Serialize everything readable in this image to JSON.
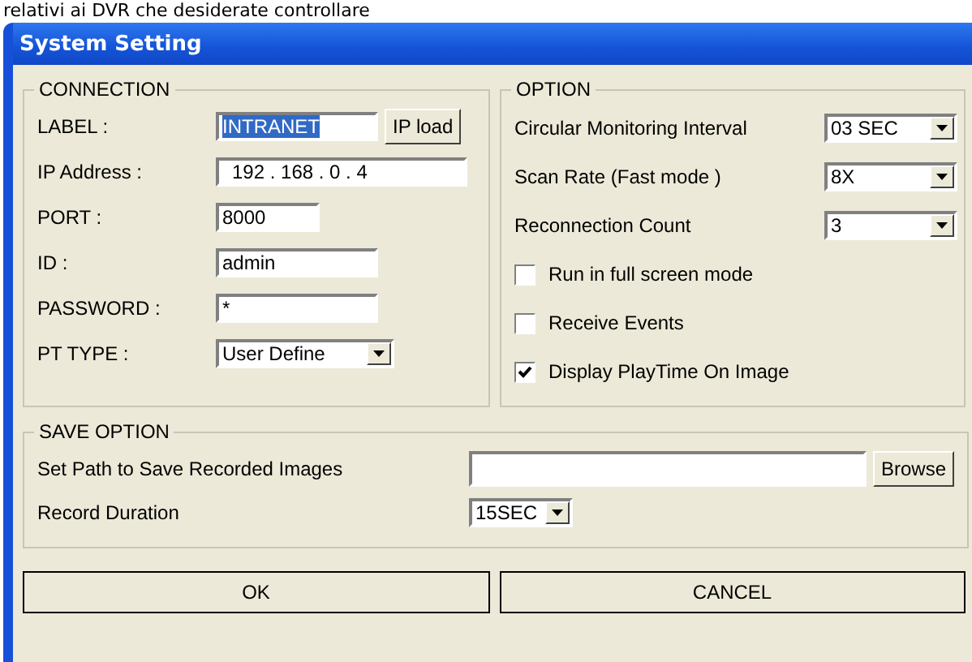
{
  "caption": "relativi ai DVR che desiderate controllare",
  "window": {
    "title": "System Setting"
  },
  "connection": {
    "title": "CONNECTION",
    "rows": [
      {
        "kind": "text",
        "label": "LABEL :",
        "value": "INTRANET",
        "selected": true,
        "button": "IP load"
      },
      {
        "kind": "ip",
        "label": "IP Address :",
        "value": "192 . 168 .  0  .  4"
      },
      {
        "kind": "short",
        "label": "PORT :",
        "value": "8000"
      },
      {
        "kind": "text",
        "label": "ID :",
        "value": "admin",
        "selected": false
      },
      {
        "kind": "text",
        "label": "PASSWORD :",
        "value": "*",
        "selected": false
      },
      {
        "kind": "combo",
        "label": "PT TYPE :",
        "value": "User Define"
      }
    ]
  },
  "option": {
    "title": "OPTION",
    "rows": [
      {
        "kind": "combo",
        "label": "Circular Monitoring Interval",
        "value": "03 SEC"
      },
      {
        "kind": "combo",
        "label": "Scan Rate (Fast mode )",
        "value": "8X"
      },
      {
        "kind": "combo",
        "label": "Reconnection Count",
        "value": "3"
      },
      {
        "kind": "check",
        "label": "Run in full screen mode",
        "checked": false
      },
      {
        "kind": "check",
        "label": "Receive Events",
        "checked": false
      },
      {
        "kind": "check",
        "label": "Display PlayTime On Image",
        "checked": true
      }
    ]
  },
  "save_option": {
    "title": "SAVE OPTION",
    "path_label": "Set Path to Save Recorded  Images",
    "browse": "Browse",
    "duration_label": "Record Duration",
    "duration": "15SEC"
  },
  "buttons": [
    "OK",
    "CANCEL"
  ]
}
